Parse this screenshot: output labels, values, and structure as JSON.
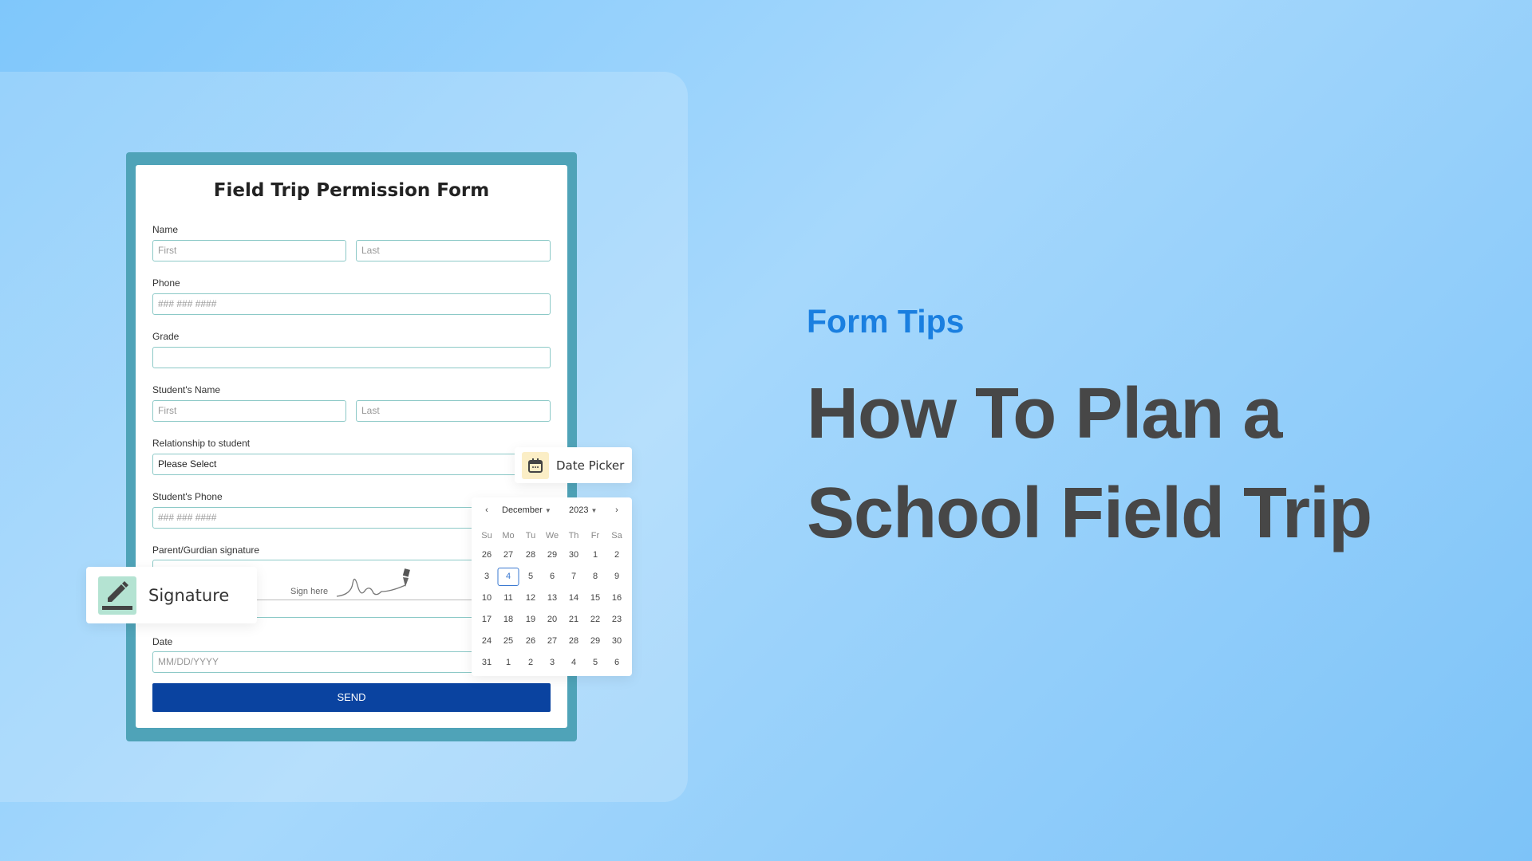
{
  "form": {
    "title": "Field Trip Permission Form",
    "name_label": "Name",
    "first_ph": "First",
    "last_ph": "Last",
    "phone_label": "Phone",
    "phone_ph": "### ### ####",
    "grade_label": "Grade",
    "student_name_label": "Student's Name",
    "relationship_label": "Relationship to student",
    "relationship_value": "Please Select",
    "student_phone_label": "Student's Phone",
    "signature_label": "Parent/Gurdian signature",
    "sign_here": "Sign here",
    "date_label": "Date",
    "date_ph": "MM/DD/YYYY",
    "send_label": "SEND"
  },
  "badges": {
    "date_picker": "Date Picker",
    "signature": "Signature"
  },
  "calendar": {
    "month": "December",
    "year": "2023",
    "selected": "4",
    "weekdays": [
      "Su",
      "Mo",
      "Tu",
      "We",
      "Th",
      "Fr",
      "Sa"
    ],
    "weeks": [
      [
        "26",
        "27",
        "28",
        "29",
        "30",
        "1",
        "2"
      ],
      [
        "3",
        "4",
        "5",
        "6",
        "7",
        "8",
        "9"
      ],
      [
        "10",
        "11",
        "12",
        "13",
        "14",
        "15",
        "16"
      ],
      [
        "17",
        "18",
        "19",
        "20",
        "21",
        "22",
        "23"
      ],
      [
        "24",
        "25",
        "26",
        "27",
        "28",
        "29",
        "30"
      ],
      [
        "31",
        "1",
        "2",
        "3",
        "4",
        "5",
        "6"
      ]
    ]
  },
  "hero": {
    "eyebrow": "Form Tips",
    "line1": "How To Plan a",
    "line2": "School Field Trip"
  },
  "colors": {
    "accent": "#1a7fe0",
    "send": "#0a43a0",
    "frame": "#4fa3b8"
  }
}
